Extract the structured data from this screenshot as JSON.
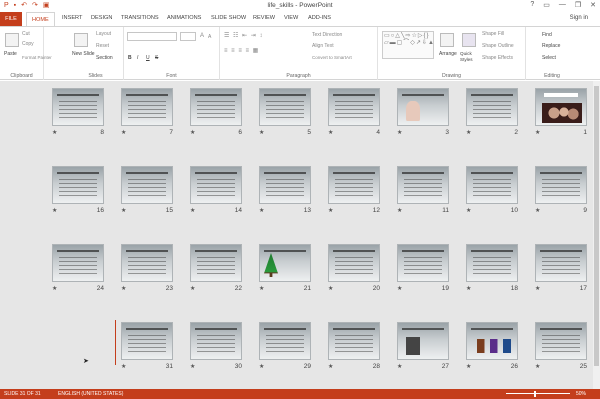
{
  "window": {
    "title": "life_skills - PowerPoint",
    "controls": [
      "?",
      "▭",
      "—",
      "❐",
      "✕"
    ]
  },
  "qat": {
    "icons": [
      "powerpoint-icon",
      "save-icon",
      "undo-icon",
      "redo-icon",
      "present-icon"
    ],
    "glyphs": [
      "P",
      "▪",
      "↶",
      "↷",
      "▣"
    ]
  },
  "tabs": {
    "file": "FILE",
    "items": [
      "HOME",
      "INSERT",
      "DESIGN",
      "TRANSITIONS",
      "ANIMATIONS",
      "SLIDE SHOW",
      "REVIEW",
      "VIEW",
      "ADD-INS"
    ],
    "signin": "Sign in"
  },
  "ribbon": {
    "clipboard": {
      "label": "Clipboard",
      "paste": "Paste",
      "cut": "Cut",
      "copy": "Copy",
      "format_painter": "Format Painter"
    },
    "slides": {
      "label": "Slides",
      "new_slide": "New Slide",
      "layout": "Layout",
      "reset": "Reset",
      "section": "Section"
    },
    "font": {
      "label": "Font",
      "bold": "B",
      "italic": "I",
      "underline": "U",
      "strike": "S",
      "sizeup": "A",
      "sizedown": "A"
    },
    "paragraph": {
      "label": "Paragraph",
      "text_direction": "Text Direction",
      "align_text": "Align Text",
      "convert": "Convert to SmartArt"
    },
    "drawing": {
      "label": "Drawing",
      "arrange": "Arrange",
      "quick_styles": "Quick Styles",
      "shape_fill": "Shape Fill",
      "shape_outline": "Shape Outline",
      "shape_effects": "Shape Effects",
      "shapes_glyphs": "▭○△╲⇨☆▷{}▱▬▢⌒◇↗⇩▲⌐◯"
    },
    "editing": {
      "label": "Editing",
      "find": "Find",
      "replace": "Replace",
      "select": "Select"
    }
  },
  "slides": [
    {
      "n": "1",
      "img": "img1"
    },
    {
      "n": "2"
    },
    {
      "n": "3",
      "img": "img3"
    },
    {
      "n": "4"
    },
    {
      "n": "5"
    },
    {
      "n": "6"
    },
    {
      "n": "7"
    },
    {
      "n": "8"
    },
    {
      "n": "9"
    },
    {
      "n": "10"
    },
    {
      "n": "11"
    },
    {
      "n": "12"
    },
    {
      "n": "13"
    },
    {
      "n": "14"
    },
    {
      "n": "15"
    },
    {
      "n": "16"
    },
    {
      "n": "17"
    },
    {
      "n": "18"
    },
    {
      "n": "19"
    },
    {
      "n": "20"
    },
    {
      "n": "21",
      "img": "img21"
    },
    {
      "n": "22"
    },
    {
      "n": "23"
    },
    {
      "n": "24"
    },
    {
      "n": "25"
    },
    {
      "n": "26",
      "img": "img26"
    },
    {
      "n": "27",
      "img": "img27"
    },
    {
      "n": "28"
    },
    {
      "n": "29"
    },
    {
      "n": "30"
    },
    {
      "n": "31"
    }
  ],
  "status": {
    "slide": "SLIDE 31 OF 31",
    "language": "ENGLISH (UNITED STATES)",
    "zoom": "50%"
  },
  "colors": {
    "accent": "#c43e1c",
    "workspace": "#e6e6e6"
  }
}
